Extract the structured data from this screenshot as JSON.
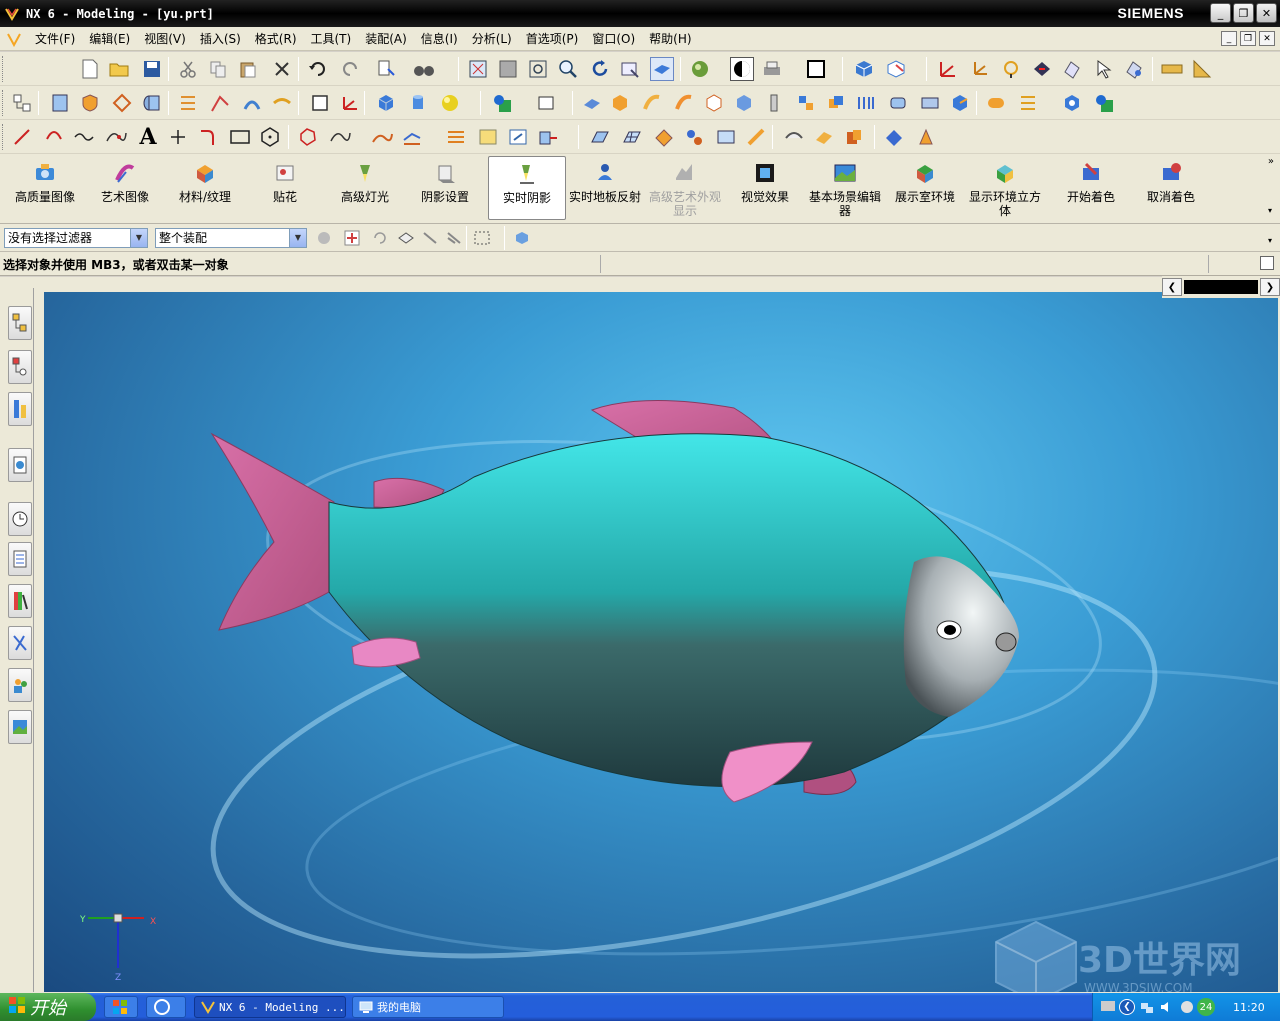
{
  "window": {
    "title": "NX 6 - Modeling - [yu.prt]",
    "brand": "SIEMENS",
    "icon": "nx-app-icon"
  },
  "menu": {
    "items": [
      "文件(F)",
      "编辑(E)",
      "视图(V)",
      "插入(S)",
      "格式(R)",
      "工具(T)",
      "装配(A)",
      "信息(I)",
      "分析(L)",
      "首选项(P)",
      "窗口(O)",
      "帮助(H)"
    ]
  },
  "toolbar": {
    "start_label": "开始"
  },
  "render_toolbar": {
    "buttons": [
      {
        "label": "高质量图像",
        "icon": "camera-icon"
      },
      {
        "label": "艺术图像",
        "icon": "palette-icon"
      },
      {
        "label": "材料/纹理",
        "icon": "material-icon"
      },
      {
        "label": "贴花",
        "icon": "decal-icon"
      },
      {
        "label": "高级灯光",
        "icon": "light-icon"
      },
      {
        "label": "阴影设置",
        "icon": "shadow-settings-icon"
      },
      {
        "label": "实时阴影",
        "icon": "realtime-shadow-icon"
      },
      {
        "label": "实时地板反射",
        "icon": "floor-reflection-icon"
      },
      {
        "label": "高级艺术外观显示",
        "icon": "advanced-studio-icon"
      },
      {
        "label": "视觉效果",
        "icon": "visual-effects-icon"
      },
      {
        "label": "基本场景编辑器",
        "icon": "scene-editor-icon"
      },
      {
        "label": "展示室环境",
        "icon": "showroom-icon"
      },
      {
        "label": "显示环境立方体",
        "icon": "environment-cube-icon"
      },
      {
        "label": "开始着色",
        "icon": "start-shading-icon"
      },
      {
        "label": "取消着色",
        "icon": "cancel-shading-icon"
      }
    ]
  },
  "filters": {
    "selection_filter": "没有选择过滤器",
    "scope": "整个装配"
  },
  "status": {
    "message": "选择对象并使用 MB3，或者双击某一对象"
  },
  "viewport": {
    "model": "fish",
    "triad_labels": {
      "x": "X",
      "y": "Y",
      "z": "Z"
    },
    "watermark_text": "3D世界网",
    "watermark_url": "WWW.3DSJW.COM"
  },
  "taskbar": {
    "start_label": "开始",
    "tasks": [
      "NX 6 - Modeling ...",
      "我的电脑"
    ],
    "clock": "11:20",
    "badge": "24"
  },
  "colors": {
    "viewport_bg": "#3a9cd4",
    "fish_body": "#2fa7a3",
    "fins": "#c06090"
  }
}
